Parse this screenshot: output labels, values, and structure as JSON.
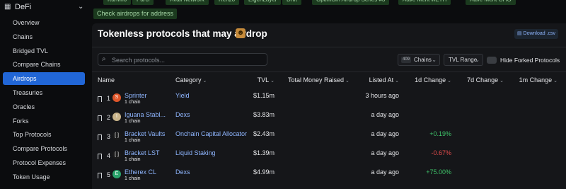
{
  "top_chips": [
    "Kamino",
    "Parcl",
    "Avail Network",
    "Renzo",
    "EigenLayer",
    "Drift",
    "Optimism Airdrop Series #3",
    "Aave Merit wETH",
    "Aave Merit GHO"
  ],
  "check_airdrops_label": "Check airdrops for address",
  "sidebar": {
    "section_label": "DeFi",
    "items": [
      {
        "label": "Overview"
      },
      {
        "label": "Chains"
      },
      {
        "label": "Bridged TVL"
      },
      {
        "label": "Compare Chains"
      },
      {
        "label": "Airdrops",
        "active": true
      },
      {
        "label": "Treasuries"
      },
      {
        "label": "Oracles"
      },
      {
        "label": "Forks"
      },
      {
        "label": "Top Protocols"
      },
      {
        "label": "Compare Protocols"
      },
      {
        "label": "Protocol Expenses"
      },
      {
        "label": "Token Usage"
      }
    ]
  },
  "panel": {
    "title": "Tokenless protocols that may airdrop",
    "download_label": "Download .csv",
    "search_placeholder": "Search protocols...",
    "chains_count": "409",
    "chains_label": "Chains",
    "tvl_range_label": "TVL Range",
    "hide_forked_label": "Hide Forked Protocols"
  },
  "table": {
    "headers": {
      "name": "Name",
      "category": "Category",
      "tvl": "TVL",
      "total_money_raised": "Total Money Raised",
      "listed_at": "Listed At",
      "change_1d": "1d Change",
      "change_7d": "7d Change",
      "change_1m": "1m Change"
    },
    "rows": [
      {
        "rank": "1",
        "name": "Sprinter",
        "chains": "1 chain",
        "category": "Yield",
        "tvl": "$1.15m",
        "listed_at": "3 hours ago",
        "change_1d": "",
        "logo_color": "#e0562a",
        "logo_glyph": "S"
      },
      {
        "rank": "2",
        "name": "Iguana Stabl...",
        "chains": "1 chain",
        "category": "Dexs",
        "tvl": "$3.83m",
        "listed_at": "a day ago",
        "change_1d": "",
        "logo_color": "#c9b48a",
        "logo_glyph": "I"
      },
      {
        "rank": "3",
        "name": "Bracket Vaults",
        "chains": "1 chain",
        "category": "Onchain Capital Allocator",
        "tvl": "$2.43m",
        "listed_at": "a day ago",
        "change_1d": "+0.19%",
        "logo_color": "#1a1a1a",
        "logo_glyph": "[ ]"
      },
      {
        "rank": "4",
        "name": "Bracket LST",
        "chains": "1 chain",
        "category": "Liquid Staking",
        "tvl": "$1.39m",
        "listed_at": "a day ago",
        "change_1d": "-0.67%",
        "logo_color": "#1a1a1a",
        "logo_glyph": "[ ]"
      },
      {
        "rank": "5",
        "name": "Etherex CL",
        "chains": "1 chain",
        "category": "Dexs",
        "tvl": "$4.99m",
        "listed_at": "a day ago",
        "change_1d": "+75.00%",
        "logo_color": "#2aa36b",
        "logo_glyph": "E"
      }
    ]
  },
  "colors": {
    "accent": "#2166d6",
    "link": "#8fb6ff",
    "positive": "#3fc46a",
    "negative": "#e24b4b"
  }
}
